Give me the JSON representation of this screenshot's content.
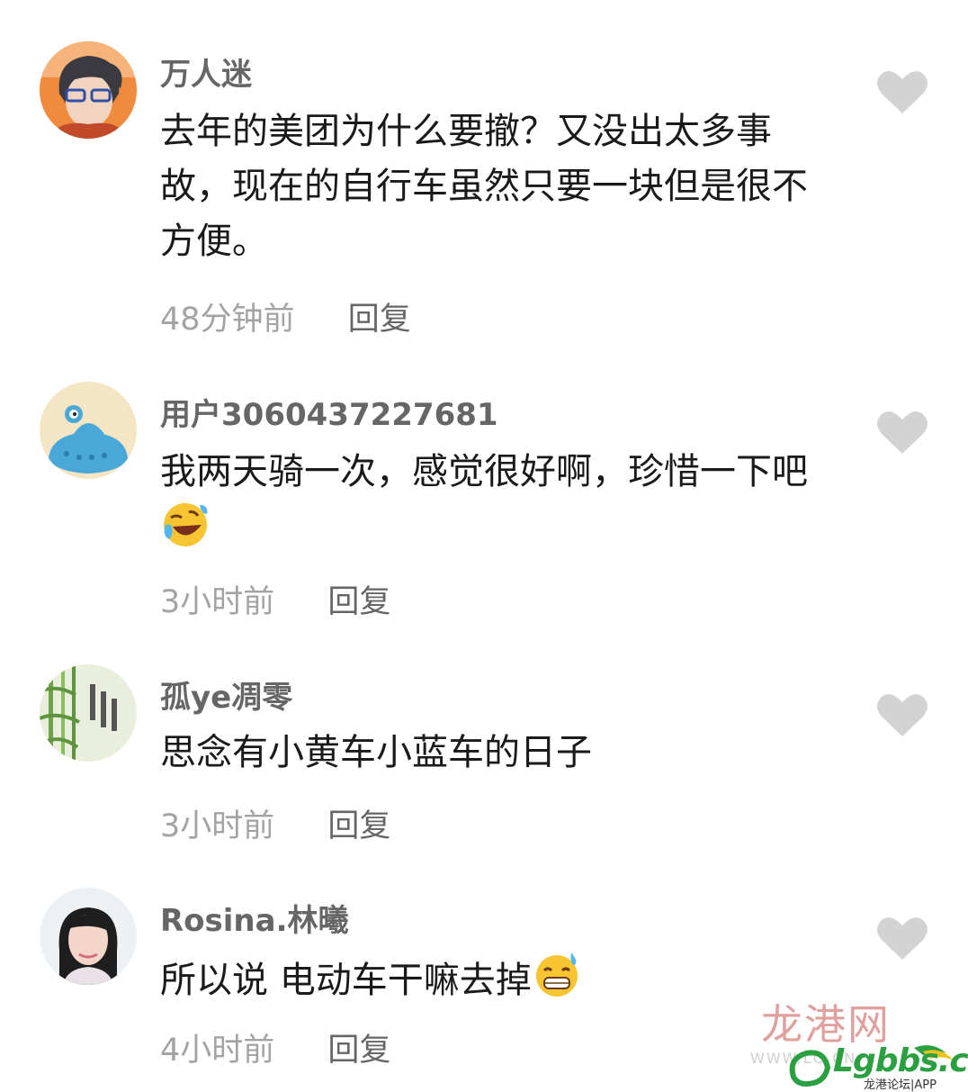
{
  "comments": [
    {
      "username": "万人迷",
      "text": "去年的美团为什么要撤？又没出太多事故，现在的自行车虽然只要一块但是很不方便。",
      "time": "48分钟前",
      "reply_label": "回复",
      "emoji": ""
    },
    {
      "username": "用户3060437227681",
      "text": "我两天骑一次，感觉很好啊，珍惜一下吧",
      "time": "3小时前",
      "reply_label": "回复",
      "emoji": "laughing-crying-emoji"
    },
    {
      "username": "孤ye凋零",
      "text": "思念有小黄车小蓝车的日子",
      "time": "3小时前",
      "reply_label": "回复",
      "emoji": ""
    },
    {
      "username": "Rosina.林曦",
      "text": "所以说 电动车干嘛去掉",
      "time": "4小时前",
      "reply_label": "回复",
      "emoji": "grinning-sweat-emoji"
    }
  ],
  "watermark": {
    "calligraphy": "龙港网",
    "www": "WWW.LG.CN",
    "brand": "Lgbbs.cn",
    "sub": "龙港论坛|APP"
  },
  "colors": {
    "like_icon": "#d3d3d3",
    "meta_text": "#a3a3a3",
    "brand_green": "#2aa041"
  }
}
